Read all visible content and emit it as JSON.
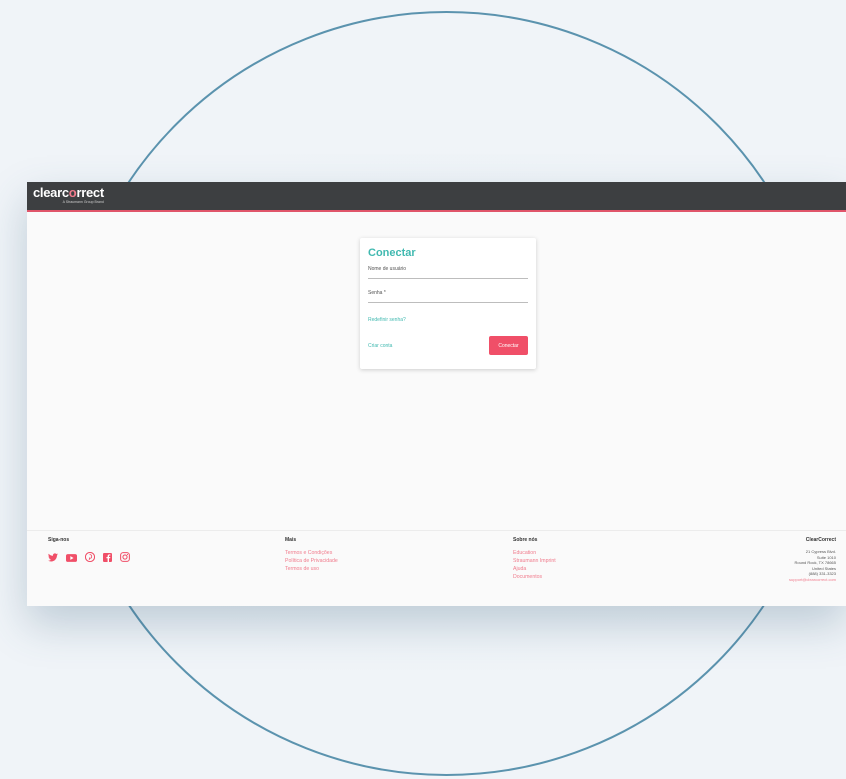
{
  "brand": {
    "logo_prefix": "clearc",
    "logo_o": "o",
    "logo_suffix": "rrect",
    "logo_tagline": "A Straumann Group Brand"
  },
  "login": {
    "title": "Conectar",
    "username_label": "Nome de usuário",
    "password_label": "Senha *",
    "reset_link": "Redefinir senha?",
    "create_link": "Criar conta",
    "submit_label": "Conectar"
  },
  "footer": {
    "social": {
      "heading": "Siga-nos",
      "icons": [
        "twitter-icon",
        "youtube-icon",
        "pinterest-icon",
        "facebook-icon",
        "instagram-icon"
      ]
    },
    "more": {
      "heading": "Mais",
      "links": [
        "Termos e Condições",
        "Política de Privacidade",
        "Termos de uso"
      ]
    },
    "about": {
      "heading": "Sobre nós",
      "links": [
        "Education",
        "Straumann Imprint",
        "Ajuda",
        "Documentos"
      ]
    },
    "company": {
      "heading": "ClearCorrect",
      "address": [
        "21 Cypress Blvd.",
        "Suite 1010",
        "Round Rock, TX 78665",
        "United States",
        "(888) 331-3323"
      ],
      "email": "support@clearcorrect.com"
    }
  },
  "colors": {
    "accent_teal": "#41b9b0",
    "accent_pink": "#f04f68",
    "topbar": "#3d3f41",
    "circle_stroke": "#5b93ae"
  }
}
